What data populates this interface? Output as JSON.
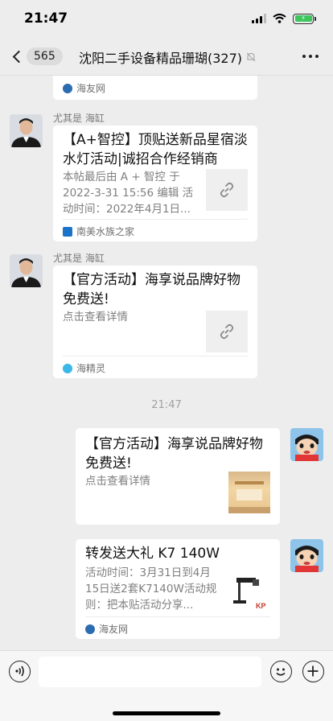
{
  "status_bar": {
    "time": "21:47",
    "battery_color": "#3cc65b"
  },
  "nav": {
    "back_count": "565",
    "title": "沈阳二手设备精品珊瑚(327)",
    "icons": {
      "back": "chevron-left-icon",
      "mute": "bell-mute-icon",
      "more": "more-dots-icon"
    }
  },
  "messages": {
    "top_partial": {
      "source": "海友网"
    },
    "msg1": {
      "sender": "尤其是 海缸",
      "title": "【A+智控】顶贴送新品星宿淡水灯活动|诚招合作经销商",
      "desc": "本帖最后由 A + 智控 于 2022-3-31 15:56 编辑 活动时间：2022年4月1日...",
      "source": "南美水族之家"
    },
    "msg2": {
      "sender": "尤其是 海缸",
      "title": "【官方活动】海享说品牌好物免费送!",
      "desc": "点击查看详情",
      "source": "海精灵"
    },
    "timestamp": "21:47",
    "msg3": {
      "title": "【官方活动】海享说品牌好物免费送!",
      "desc": "点击查看详情"
    },
    "msg4": {
      "title": "转发送大礼 K7 140W",
      "desc": "活动时间：3月31日到4月15日送2套K7140W活动规则：把本贴活动分享...",
      "source": "海友网",
      "thumb_brand": "KP"
    }
  },
  "input_bar": {
    "icons": {
      "voice": "voice-icon",
      "emoji": "emoji-icon",
      "plus": "plus-icon"
    }
  },
  "colors": {
    "background": "#ededed",
    "card": "#ffffff",
    "link_thumb": "#efefef"
  }
}
